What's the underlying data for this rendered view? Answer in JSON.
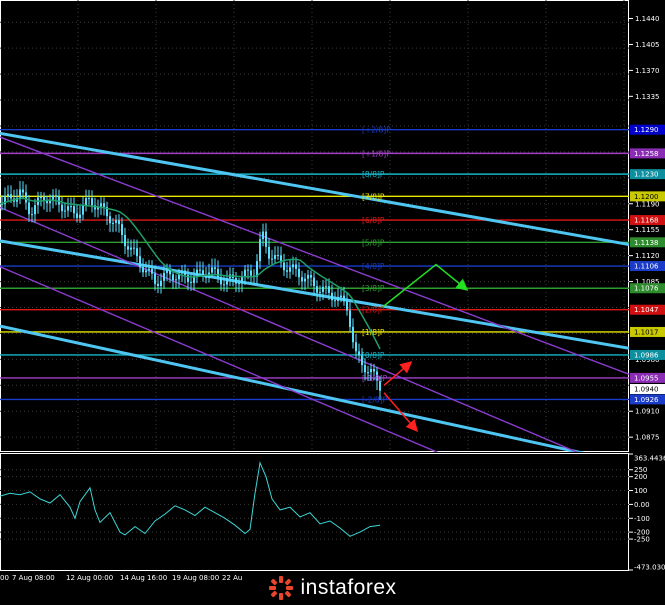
{
  "chart_data": [
    {
      "type": "line",
      "panel": "price",
      "y_range": [
        1.0855,
        1.1465
      ],
      "y_ticks": [
        "1.1440",
        "1.1405",
        "1.1370",
        "1.1335",
        "1.1290",
        "1.1258",
        "1.1230",
        "1.1200",
        "1.1190",
        "1.1168",
        "1.1155",
        "1.1138",
        "1.1120",
        "1.1106",
        "1.1085",
        "1.1076",
        "1.1047",
        "1.1017",
        "1.0980",
        "1.0986",
        "1.0955",
        "1.0940",
        "1.0910",
        "1.0875"
      ],
      "price_labels": [
        {
          "value": 1.129,
          "text": "1.1290",
          "color": "#0000cc"
        },
        {
          "value": 1.1258,
          "text": "1.1258",
          "color": "#8b2cb5"
        },
        {
          "value": 1.123,
          "text": "1.1230",
          "color": "#0e8fa0"
        },
        {
          "value": 1.12,
          "text": "1.1200",
          "color": "#c9c900"
        },
        {
          "value": 1.1168,
          "text": "1.1168",
          "color": "#d01010"
        },
        {
          "value": 1.1138,
          "text": "1.1138",
          "color": "#2e8b2e"
        },
        {
          "value": 1.1106,
          "text": "1.1106",
          "color": "#1a3cc8"
        },
        {
          "value": 1.1076,
          "text": "1.1076",
          "color": "#2e8b2e"
        },
        {
          "value": 1.1047,
          "text": "1.1047",
          "color": "#d01010"
        },
        {
          "value": 1.1017,
          "text": "1.1017",
          "color": "#c9c900"
        },
        {
          "value": 1.0986,
          "text": "1.0986",
          "color": "#0e8fa0"
        },
        {
          "value": 1.0955,
          "text": "1.0955",
          "color": "#8b2cb5"
        },
        {
          "value": 1.094,
          "text": "1.0940",
          "color": "#ffffff"
        },
        {
          "value": 1.0926,
          "text": "1.0926",
          "color": "#1a3cc8"
        }
      ],
      "murrey_levels": [
        {
          "label": "[+2/8]P",
          "value": 1.129,
          "color": "#1a3cc8"
        },
        {
          "label": "[+1/8]P",
          "value": 1.1258,
          "color": "#a33fc8"
        },
        {
          "label": "[8/8]P",
          "value": 1.123,
          "color": "#16b6c8"
        },
        {
          "label": "[7/8]P",
          "value": 1.12,
          "color": "#e8e800"
        },
        {
          "label": "[6/8]P",
          "value": 1.1168,
          "color": "#e01818"
        },
        {
          "label": "[5/8]P",
          "value": 1.1138,
          "color": "#2e9b2e"
        },
        {
          "label": "[4/8]P",
          "value": 1.1106,
          "color": "#1a3cc8"
        },
        {
          "label": "[3/8]P",
          "value": 1.1076,
          "color": "#2e9b2e"
        },
        {
          "label": "[2/8]P",
          "value": 1.1047,
          "color": "#e01818"
        },
        {
          "label": "[1/8]P",
          "value": 1.1017,
          "color": "#e8e800"
        },
        {
          "label": "[0/8]P",
          "value": 1.0986,
          "color": "#16b6c8"
        },
        {
          "label": "[-1/8]P",
          "value": 1.0955,
          "color": "#a33fc8"
        },
        {
          "label": "[-2/8]P",
          "value": 1.0926,
          "color": "#1a3cc8"
        }
      ],
      "x_labels": [
        "00",
        "7 Aug 08:00",
        "12 Aug 00:00",
        "14 Aug 16:00",
        "19 Aug 08:00",
        "22 Au"
      ]
    },
    {
      "type": "line",
      "panel": "indicator",
      "y_range": [
        -473.0309,
        363.4436
      ],
      "y_ticks": [
        "363.4436",
        "250",
        "200",
        "100",
        "0.00",
        "-100",
        "-200",
        "-250",
        "-473.0309"
      ]
    }
  ],
  "logo": {
    "text": "instaforex"
  }
}
